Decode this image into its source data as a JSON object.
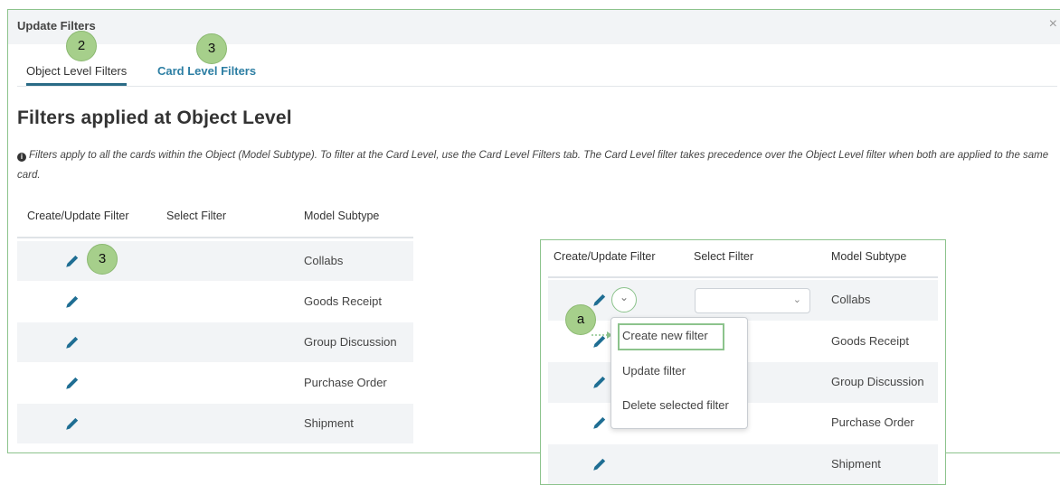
{
  "dialog": {
    "title": "Update Filters",
    "close": "×"
  },
  "tabs": [
    {
      "label": "Object Level Filters",
      "badge": "2"
    },
    {
      "label": "Card Level Filters",
      "badge": "3"
    }
  ],
  "heading": "Filters applied at Object Level",
  "info_text": "Filters apply to all the cards within the Object (Model Subtype). To filter at the Card Level, use the Card Level Filters tab. The Card Level filter takes precedence over the Object Level filter when both are applied to the same card.",
  "table": {
    "headers": [
      "Create/Update Filter",
      "Select Filter",
      "Model Subtype"
    ],
    "rows": [
      "Collabs",
      "Goods Receipt",
      "Group Discussion",
      "Purchase Order",
      "Shipment"
    ],
    "row_badge": "3"
  },
  "panel": {
    "headers": [
      "Create/Update Filter",
      "Select Filter",
      "Model Subtype"
    ],
    "rows": [
      "Collabs",
      "Goods Receipt",
      "Group Discussion",
      "Purchase Order",
      "Shipment"
    ],
    "select_value": "",
    "badge": "a",
    "menu": [
      "Create new filter",
      "Update filter",
      "Delete selected filter"
    ]
  },
  "colors": {
    "accent": "#2a6b86",
    "link": "#2c7ea3",
    "callout": "#a6cf8b",
    "pencil": "#1f6e93"
  }
}
